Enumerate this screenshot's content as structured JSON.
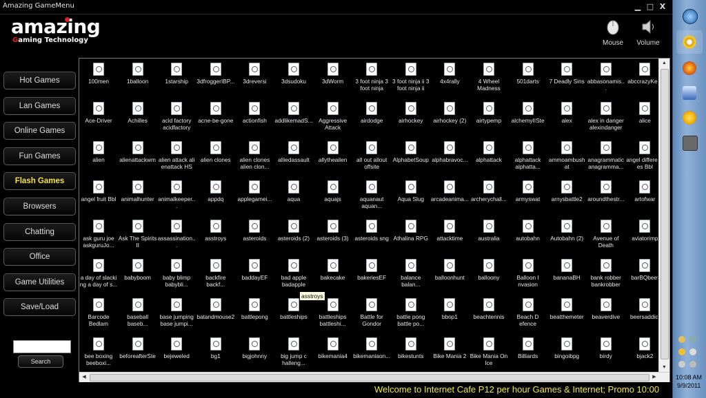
{
  "window": {
    "title": "Amazing GameMenu",
    "min_glyph": "▁",
    "max_glyph": "□",
    "close_glyph": "X"
  },
  "logo": {
    "word": "amazing",
    "tagline_g": "G",
    "tagline_rest": "aming Technology"
  },
  "top_icons": [
    {
      "label": "Mouse",
      "icon": "mouse-icon"
    },
    {
      "label": "Volume",
      "icon": "speaker-icon"
    }
  ],
  "sidebar": {
    "items": [
      {
        "label": "Hot Games",
        "active": false
      },
      {
        "label": "Lan Games",
        "active": false
      },
      {
        "label": "Online Games",
        "active": false
      },
      {
        "label": "Fun Games",
        "active": false
      },
      {
        "label": "Flash Games",
        "active": true
      },
      {
        "label": "Browsers",
        "active": false
      },
      {
        "label": "Chatting",
        "active": false
      },
      {
        "label": "Office",
        "active": false
      },
      {
        "label": "Game Utilities",
        "active": false
      },
      {
        "label": "Save/Load",
        "active": false
      }
    ]
  },
  "search": {
    "value": "",
    "button_label": "Search"
  },
  "games": {
    "columns": 15,
    "items": [
      "100men",
      "1balloon",
      "1starship",
      "3dfroggerIBP...",
      "3dreversi",
      "3dsudoku",
      "3dWorm",
      "3 foot ninja 3 foot ninja",
      "3 foot ninja ii 3 foot ninja ii",
      "4x4rally",
      "4 Wheel Madness",
      "501darts",
      "7 Deadly Sins",
      "abbasonamis...",
      "abccrazyKe...",
      "Ace-Driver",
      "Achilles",
      "acid factory acidfactory",
      "acne-be-gone",
      "actionfish",
      "addlikemadS...",
      "Aggressive Attack",
      "airdodge",
      "airhockey",
      "airhockey (2)",
      "airtypemp",
      "alchemyIISte",
      "alex",
      "alex in danger alexindanger",
      "alice",
      "alien",
      "alienattackwm",
      "alien attack ali enattack HS",
      "alien clones",
      "alien clones alien clon...",
      "alliedassault",
      "allytheailen",
      "all out allout offsite",
      "AlphabetSoup",
      "alphabravoc...",
      "alphattack",
      "alphattack alphatta...",
      "ammoambush at",
      "anagrammatic anagramma...",
      "angel differenc es Bbl",
      "angel fruit Bbl",
      "animalhunter",
      "animalkeeper...",
      "appdq",
      "applegamei...",
      "aqua",
      "aquajs",
      "aquanaut aquan...",
      "Aqua Slug",
      "arcadeanima...",
      "archerychall...",
      "armyswat",
      "arnysbattle2",
      "aroundthestr...",
      "artofwar",
      "ask guru joe askguruJo...",
      "Ask The Spirits II",
      "assassination...",
      "asstroys",
      "asteroids",
      "asteroids (2)",
      "asteroids (3)",
      "asteroids sng",
      "Athalina RPG",
      "attacktime",
      "australia",
      "autobahn",
      "Autobahn (2)",
      "Avenue of Death",
      "aviatorimp",
      "a day of slacki ng a day of s...",
      "babyboom",
      "baby blimp babybli...",
      "backfire backf...",
      "baddayEF",
      "bad apple badapple",
      "bakecake",
      "bakeriesEF",
      "balance balan...",
      "balloonhunt",
      "balloony",
      "Balloon I nvasion",
      "bananaBH",
      "bank robber bankrobber",
      "barBQbeef",
      "Barcode Bedlam",
      "baseball baseb...",
      "base jumping base jumpi...",
      "batandmouse2",
      "battlepong",
      "battleships",
      "battleships battleshi...",
      "Battle for Gondor",
      "battle pong battle po...",
      "bbop1",
      "beachtennis",
      "Beach D efence",
      "beatthemeter",
      "beaverdive",
      "beersaddict",
      "bee boxing beeboxi...",
      "beforeafterSte",
      "bejeweled",
      "bg1",
      "bigjohnny",
      "big jump c halleng...",
      "bikemania4",
      "bikemaniaon...",
      "bikestunts",
      "Bike Mania 2",
      "Bike Mania On Ice",
      "Billiards",
      "bingoibpg",
      "birdy",
      "bjack2"
    ]
  },
  "tooltip": "asstroys",
  "ticker": "Welcome to          Internet Cafe P12 per hour Games & Internet; Promo 10:00",
  "taskbar": {
    "icons": [
      "windows-orb-icon",
      "disc-icon",
      "firefox-icon",
      "computer-icon",
      "yahoo-messenger-icon",
      "game-icon"
    ],
    "time": "10:08 AM",
    "date": "9/9/2011"
  },
  "colors": {
    "active_nav": "#f5e23a",
    "ticker": "#f2e93a",
    "logo_accent": "#e02020"
  }
}
